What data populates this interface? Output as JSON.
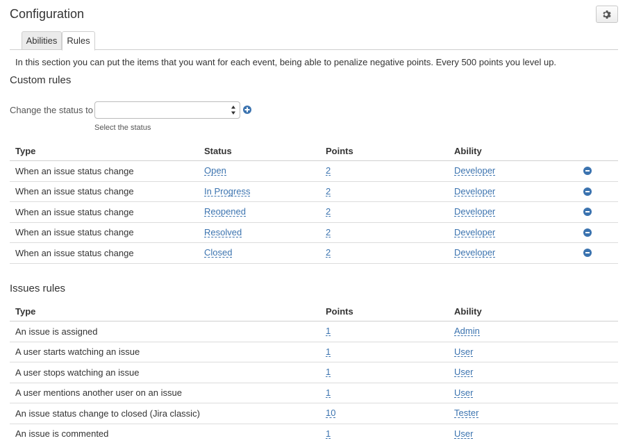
{
  "page": {
    "title": "Configuration"
  },
  "tabs": [
    {
      "label": "Abilities",
      "active": false
    },
    {
      "label": "Rules",
      "active": true
    }
  ],
  "description": "In this section you can put the items that you want for each event, being able to penalize negative points. Every 500 points you level up.",
  "custom_rules": {
    "title": "Custom rules",
    "status_label": "Change the status to",
    "status_value": "",
    "status_helper": "Select the status",
    "headers": {
      "type": "Type",
      "status": "Status",
      "points": "Points",
      "ability": "Ability"
    },
    "rows": [
      {
        "type": "When an issue status change",
        "status": "Open",
        "points": "2",
        "ability": "Developer"
      },
      {
        "type": "When an issue status change",
        "status": "In Progress",
        "points": "2",
        "ability": "Developer"
      },
      {
        "type": "When an issue status change",
        "status": "Reopened",
        "points": "2",
        "ability": "Developer"
      },
      {
        "type": "When an issue status change",
        "status": "Resolved",
        "points": "2",
        "ability": "Developer"
      },
      {
        "type": "When an issue status change",
        "status": "Closed",
        "points": "2",
        "ability": "Developer"
      }
    ]
  },
  "issues_rules": {
    "title": "Issues rules",
    "headers": {
      "type": "Type",
      "points": "Points",
      "ability": "Ability"
    },
    "rows": [
      {
        "type": "An issue is assigned",
        "points": "1",
        "ability": "Admin"
      },
      {
        "type": "A user starts watching an issue",
        "points": "1",
        "ability": "User"
      },
      {
        "type": "A user stops watching an issue",
        "points": "1",
        "ability": "User"
      },
      {
        "type": "A user mentions another user on an issue",
        "points": "1",
        "ability": "User"
      },
      {
        "type": "An issue status change to closed (Jira classic)",
        "points": "10",
        "ability": "Tester"
      },
      {
        "type": "An issue is commented",
        "points": "1",
        "ability": "User"
      }
    ]
  },
  "colors": {
    "link": "#3b73af",
    "text": "#333333",
    "border": "#dcdcdc"
  },
  "icons": {
    "settings": "gear-icon",
    "add": "plus-circle-icon",
    "remove": "minus-circle-icon"
  }
}
